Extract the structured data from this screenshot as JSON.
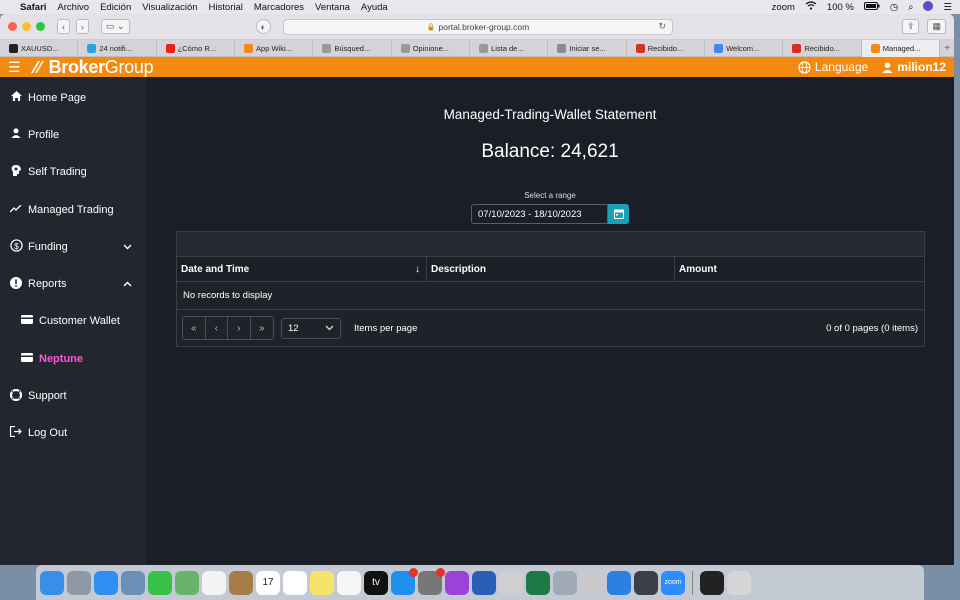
{
  "menubar": {
    "app": "Safari",
    "items": [
      "Archivo",
      "Edición",
      "Visualización",
      "Historial",
      "Marcadores",
      "Ventana",
      "Ayuda"
    ],
    "zoom": "zoom",
    "battery": "100 %"
  },
  "browser": {
    "url": "portal.broker-group.com",
    "tabs": [
      {
        "label": "XAUUSD...",
        "color": "#222222"
      },
      {
        "label": "24 notifi...",
        "color": "#2aa3e0"
      },
      {
        "label": "¿Cómo R...",
        "color": "#e62117"
      },
      {
        "label": "App Wiki...",
        "color": "#f28a12"
      },
      {
        "label": "Búsqued...",
        "color": "#999999"
      },
      {
        "label": "Opinione...",
        "color": "#999999"
      },
      {
        "label": "Lista de...",
        "color": "#999999"
      },
      {
        "label": "Iniciar se...",
        "color": "#8a8a9a"
      },
      {
        "label": "Recibido...",
        "color": "#d93025"
      },
      {
        "label": "Welcom...",
        "color": "#4285f4"
      },
      {
        "label": "Recibido...",
        "color": "#d93025"
      },
      {
        "label": "Managed...",
        "color": "#f28a12"
      }
    ]
  },
  "header": {
    "brand_bold": "Broker",
    "brand_light": "Group",
    "language": "Language",
    "user": "milion12",
    "color": "#f28a12"
  },
  "sidebar": {
    "items": [
      {
        "label": "Home Page",
        "icon": "home-icon"
      },
      {
        "label": "Profile",
        "icon": "user-icon"
      },
      {
        "label": "Self Trading",
        "icon": "brain-icon"
      },
      {
        "label": "Managed Trading",
        "icon": "trend-icon"
      },
      {
        "label": "Funding",
        "icon": "dollar-icon"
      },
      {
        "label": "Reports",
        "icon": "alert-icon"
      },
      {
        "label": "Customer Wallet",
        "icon": "wallet-icon"
      },
      {
        "label": "Neptune",
        "icon": "wallet-icon"
      },
      {
        "label": "Support",
        "icon": "lifebuoy-icon"
      },
      {
        "label": "Log Out",
        "icon": "logout-icon"
      }
    ],
    "active_color": "#ff57d6"
  },
  "main": {
    "title": "Managed-Trading-Wallet Statement",
    "balance": "Balance: 24,621",
    "range_label": "Select a range",
    "range_value": "07/10/2023 - 18/10/2023",
    "grid": {
      "columns": [
        "Date and Time",
        "Description",
        "Amount"
      ],
      "empty_text": "No records to display",
      "page_size": "12",
      "items_per_page_label": "Items per page",
      "pager_info": "0 of 0 pages (0 items)"
    }
  },
  "dock": {
    "apps": [
      "finder",
      "launchpad",
      "safari",
      "preview",
      "facetime",
      "maps",
      "photos",
      "notes-book",
      "calendar",
      "reminders",
      "stickies",
      "music",
      "tv",
      "app-store",
      "system-preferences",
      "podcasts",
      "word",
      "xquartz",
      "excel",
      "image-capture",
      "keychain",
      "bluetooth",
      "quicktime",
      "zoom",
      "phone",
      "trash"
    ],
    "calendar_day": "17",
    "tv_label": "tv",
    "zoom_label": "zoom"
  }
}
